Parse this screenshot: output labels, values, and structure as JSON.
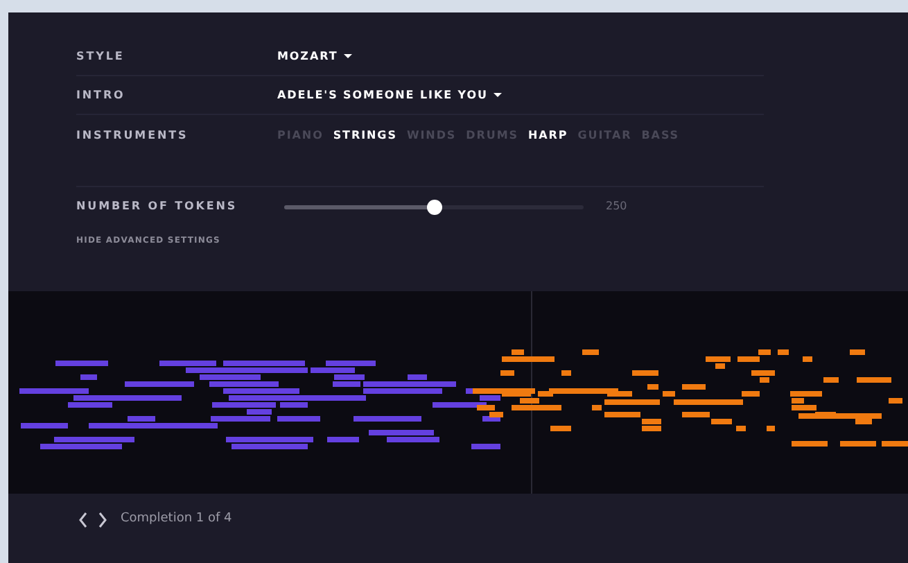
{
  "settings": {
    "style": {
      "label": "STYLE",
      "value": "MOZART"
    },
    "intro": {
      "label": "INTRO",
      "value": "ADELE'S SOMEONE LIKE YOU"
    },
    "instruments": {
      "label": "INSTRUMENTS",
      "items": [
        {
          "name": "PIANO",
          "selected": false
        },
        {
          "name": "STRINGS",
          "selected": true
        },
        {
          "name": "WINDS",
          "selected": false
        },
        {
          "name": "DRUMS",
          "selected": false
        },
        {
          "name": "HARP",
          "selected": true
        },
        {
          "name": "GUITAR",
          "selected": false
        },
        {
          "name": "BASS",
          "selected": false
        }
      ]
    },
    "tokens": {
      "label": "NUMBER OF TOKENS",
      "level": 0.5,
      "reading": "250"
    },
    "advanced_link": "HIDE ADVANCED SETTINGS"
  },
  "completion": {
    "label": "Completion 1 of 4"
  }
}
